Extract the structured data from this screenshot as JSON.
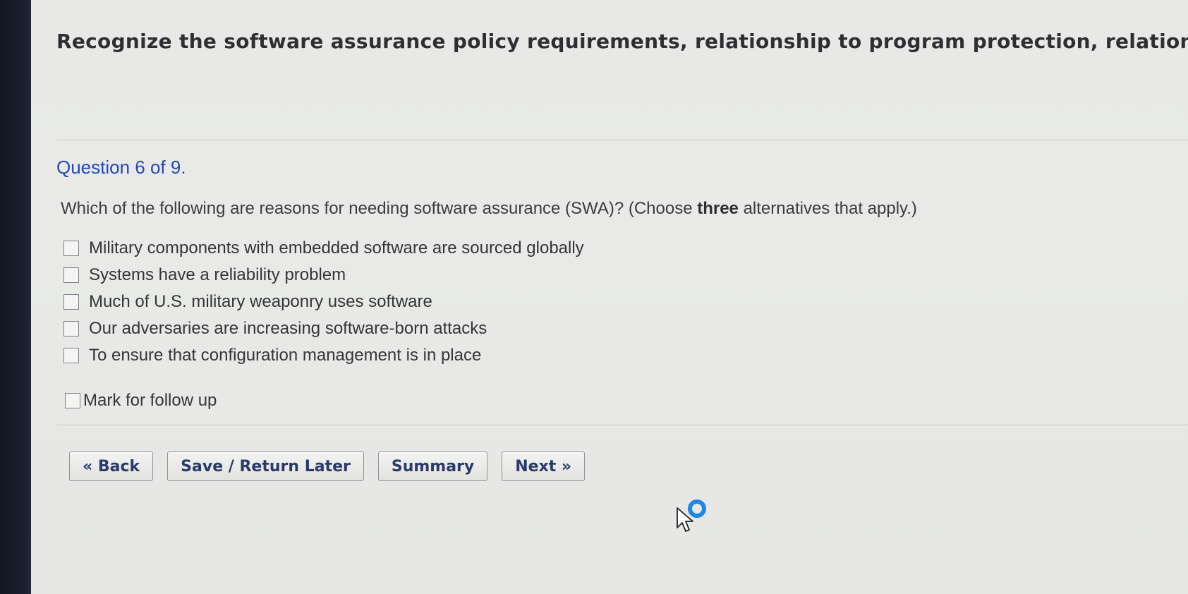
{
  "page": {
    "title": "Recognize the software assurance policy requirements, relationship to program protection, relations"
  },
  "question": {
    "header": "Question 6 of 9.",
    "text_before": "Which of the following are reasons for needing software assurance (SWA)? (Choose ",
    "text_emphasis": "three",
    "text_after": " alternatives that apply.)",
    "options": [
      {
        "label": "Military components with embedded software are sourced globally",
        "checked": false
      },
      {
        "label": "Systems have a reliability problem",
        "checked": false
      },
      {
        "label": "Much of U.S. military weaponry uses software",
        "checked": false
      },
      {
        "label": "Our adversaries are increasing software-born attacks",
        "checked": false
      },
      {
        "label": "To ensure that configuration management is in place",
        "checked": false
      }
    ],
    "followup_label": "Mark for follow up"
  },
  "nav": {
    "back_label": "« Back",
    "save_label": "Save / Return Later",
    "summary_label": "Summary",
    "next_label": "Next »"
  },
  "icons": {
    "cursor": "busy-arrow-cursor-icon"
  },
  "colors": {
    "question_header": "#2348b8",
    "button_text": "#2a3a6a",
    "busy_ring": "#1e88e5"
  }
}
